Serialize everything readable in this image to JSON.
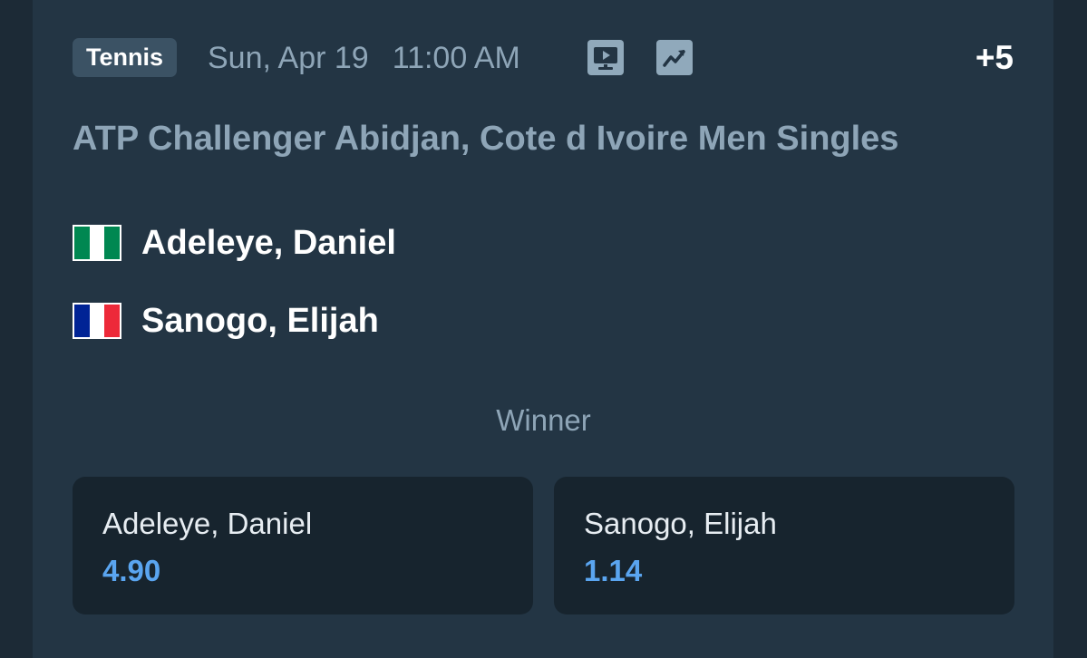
{
  "event": {
    "sport": "Tennis",
    "date": "Sun, Apr 19",
    "time": "11:00 AM",
    "more_markets": "+5",
    "league": "ATP Challenger Abidjan, Cote d Ivoire Men Singles"
  },
  "icons": {
    "tv": "live-stream-tv-icon",
    "stats": "statistics-chart-icon"
  },
  "players": [
    {
      "name": "Adeleye, Daniel",
      "flag": "nigeria-flag",
      "flag_colors": [
        "#008751",
        "#ffffff",
        "#008751"
      ]
    },
    {
      "name": "Sanogo, Elijah",
      "flag": "france-flag",
      "flag_colors": [
        "#002395",
        "#ffffff",
        "#ed2939"
      ]
    }
  ],
  "market": {
    "label": "Winner",
    "selections": [
      {
        "name": "Adeleye, Daniel",
        "odds": "4.90"
      },
      {
        "name": "Sanogo, Elijah",
        "odds": "1.14"
      }
    ]
  },
  "colors": {
    "background": "#1c2a36",
    "card": "#233544",
    "muted_text": "#8ea5b7",
    "odds_accent": "#5aa5f0",
    "odds_button": "#17242e"
  }
}
